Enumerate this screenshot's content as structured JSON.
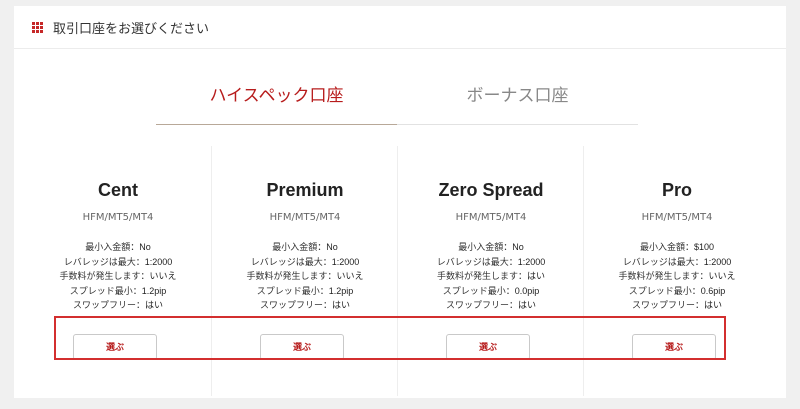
{
  "header": {
    "title": "取引口座をお選びください",
    "icon": "grid-icon"
  },
  "tabs": [
    {
      "label": "ハイスペック口座",
      "active": true
    },
    {
      "label": "ボーナス口座",
      "active": false
    }
  ],
  "accounts": [
    {
      "name": "Cent",
      "platform": "HFM/MT5/MT4",
      "specs": [
        {
          "label": "最小入金額：",
          "value": "No"
        },
        {
          "label": "レバレッジは最大：",
          "value": "1:2000"
        },
        {
          "label": "手数料が発生します：",
          "value": "いいえ"
        },
        {
          "label": "スプレッド最小：",
          "value": "1.2pip"
        },
        {
          "label": "スワップフリー：",
          "value": "はい"
        }
      ],
      "button": "選ぶ"
    },
    {
      "name": "Premium",
      "platform": "HFM/MT5/MT4",
      "specs": [
        {
          "label": "最小入金額：",
          "value": "No"
        },
        {
          "label": "レバレッジは最大：",
          "value": "1:2000"
        },
        {
          "label": "手数料が発生します：",
          "value": "いいえ"
        },
        {
          "label": "スプレッド最小：",
          "value": "1.2pip"
        },
        {
          "label": "スワップフリー：",
          "value": "はい"
        }
      ],
      "button": "選ぶ"
    },
    {
      "name": "Zero Spread",
      "platform": "HFM/MT5/MT4",
      "specs": [
        {
          "label": "最小入金額：",
          "value": "No"
        },
        {
          "label": "レバレッジは最大：",
          "value": "1:2000"
        },
        {
          "label": "手数料が発生します：",
          "value": "はい"
        },
        {
          "label": "スプレッド最小：",
          "value": "0.0pip"
        },
        {
          "label": "スワップフリー：",
          "value": "はい"
        }
      ],
      "button": "選ぶ"
    },
    {
      "name": "Pro",
      "platform": "HFM/MT5/MT4",
      "specs": [
        {
          "label": "最小入金額：",
          "value": "$100"
        },
        {
          "label": "レバレッジは最大：",
          "value": "1:2000"
        },
        {
          "label": "手数料が発生します：",
          "value": "いいえ"
        },
        {
          "label": "スプレッド最小：",
          "value": "0.6pip"
        },
        {
          "label": "スワップフリー：",
          "value": "はい"
        }
      ],
      "button": "選ぶ"
    }
  ],
  "colors": {
    "accent": "#b71c1c",
    "highlight": "#d32f2f",
    "background": "#f0f0f0"
  }
}
